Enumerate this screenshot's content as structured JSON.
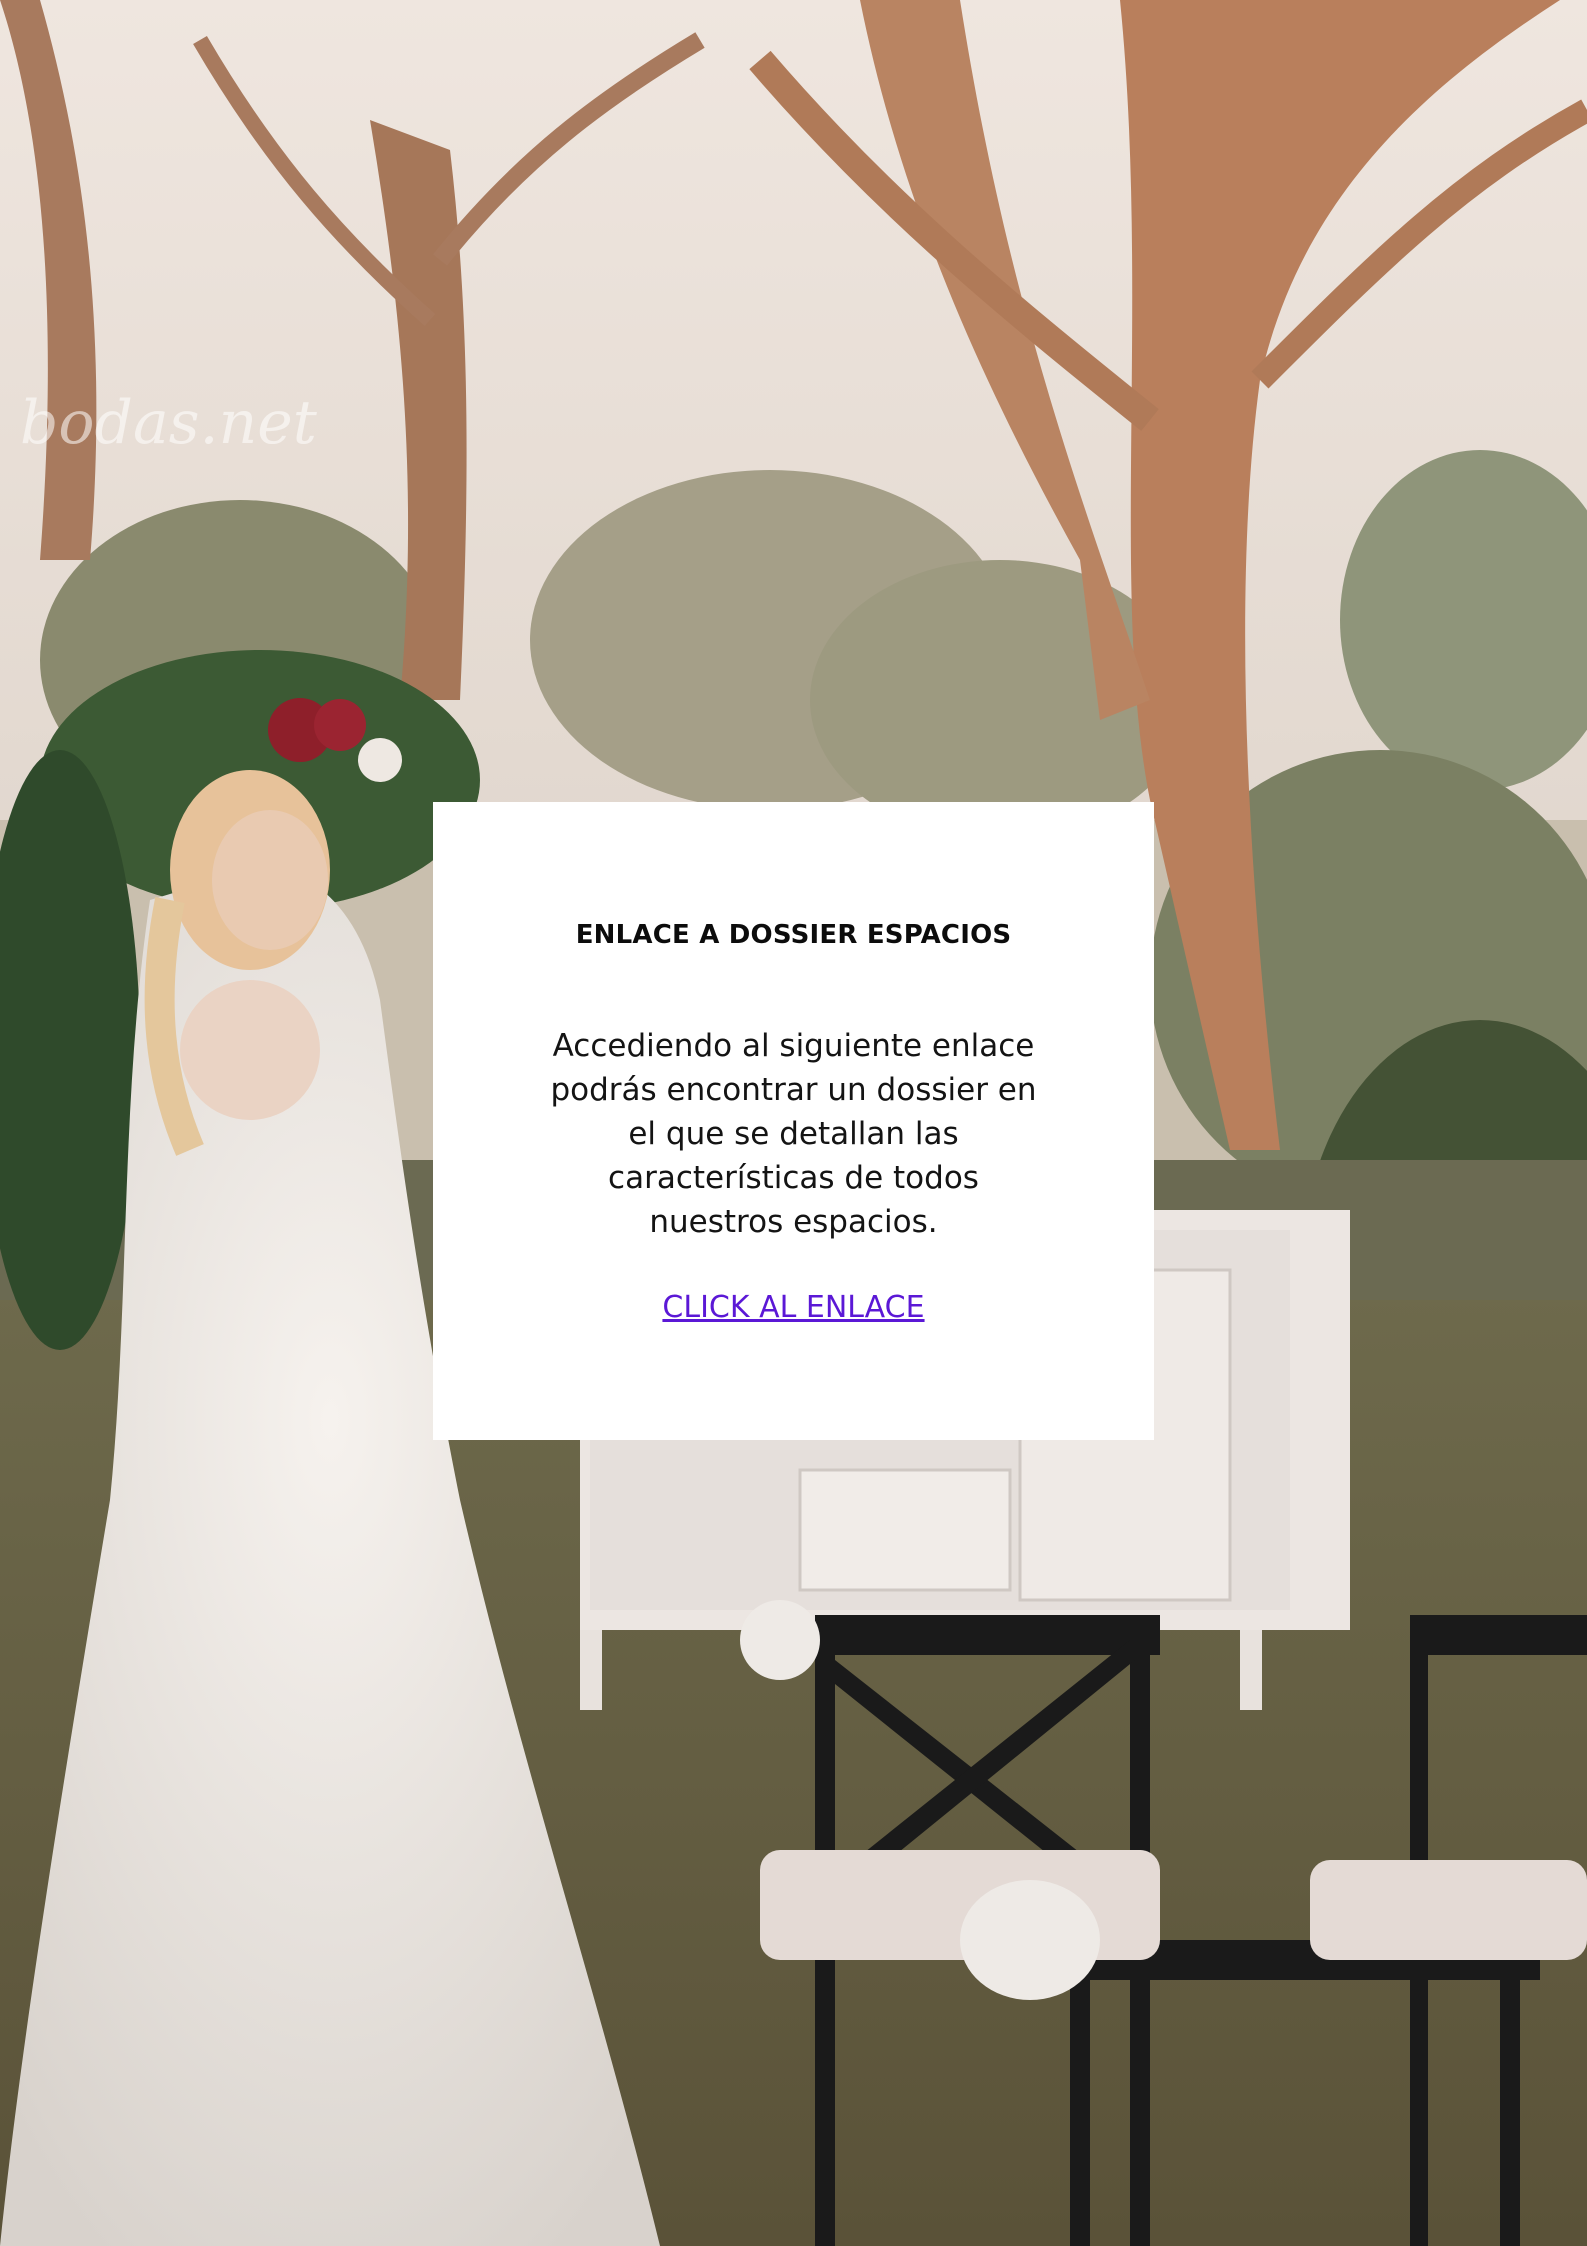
{
  "photo": {
    "description": "wedding-garden-photo",
    "watermark": "bodas.net"
  },
  "card": {
    "title": "ENLACE A DOSSIER ESPACIOS",
    "body": "Accediendo al siguiente enlace podrás encontrar un dossier en el que se detallan las características de todos nuestros espacios.",
    "link_label": "CLICK AL ENLACE"
  },
  "colors": {
    "link": "#5b18d6",
    "card_bg": "#ffffff",
    "title": "#0c0c0c"
  }
}
